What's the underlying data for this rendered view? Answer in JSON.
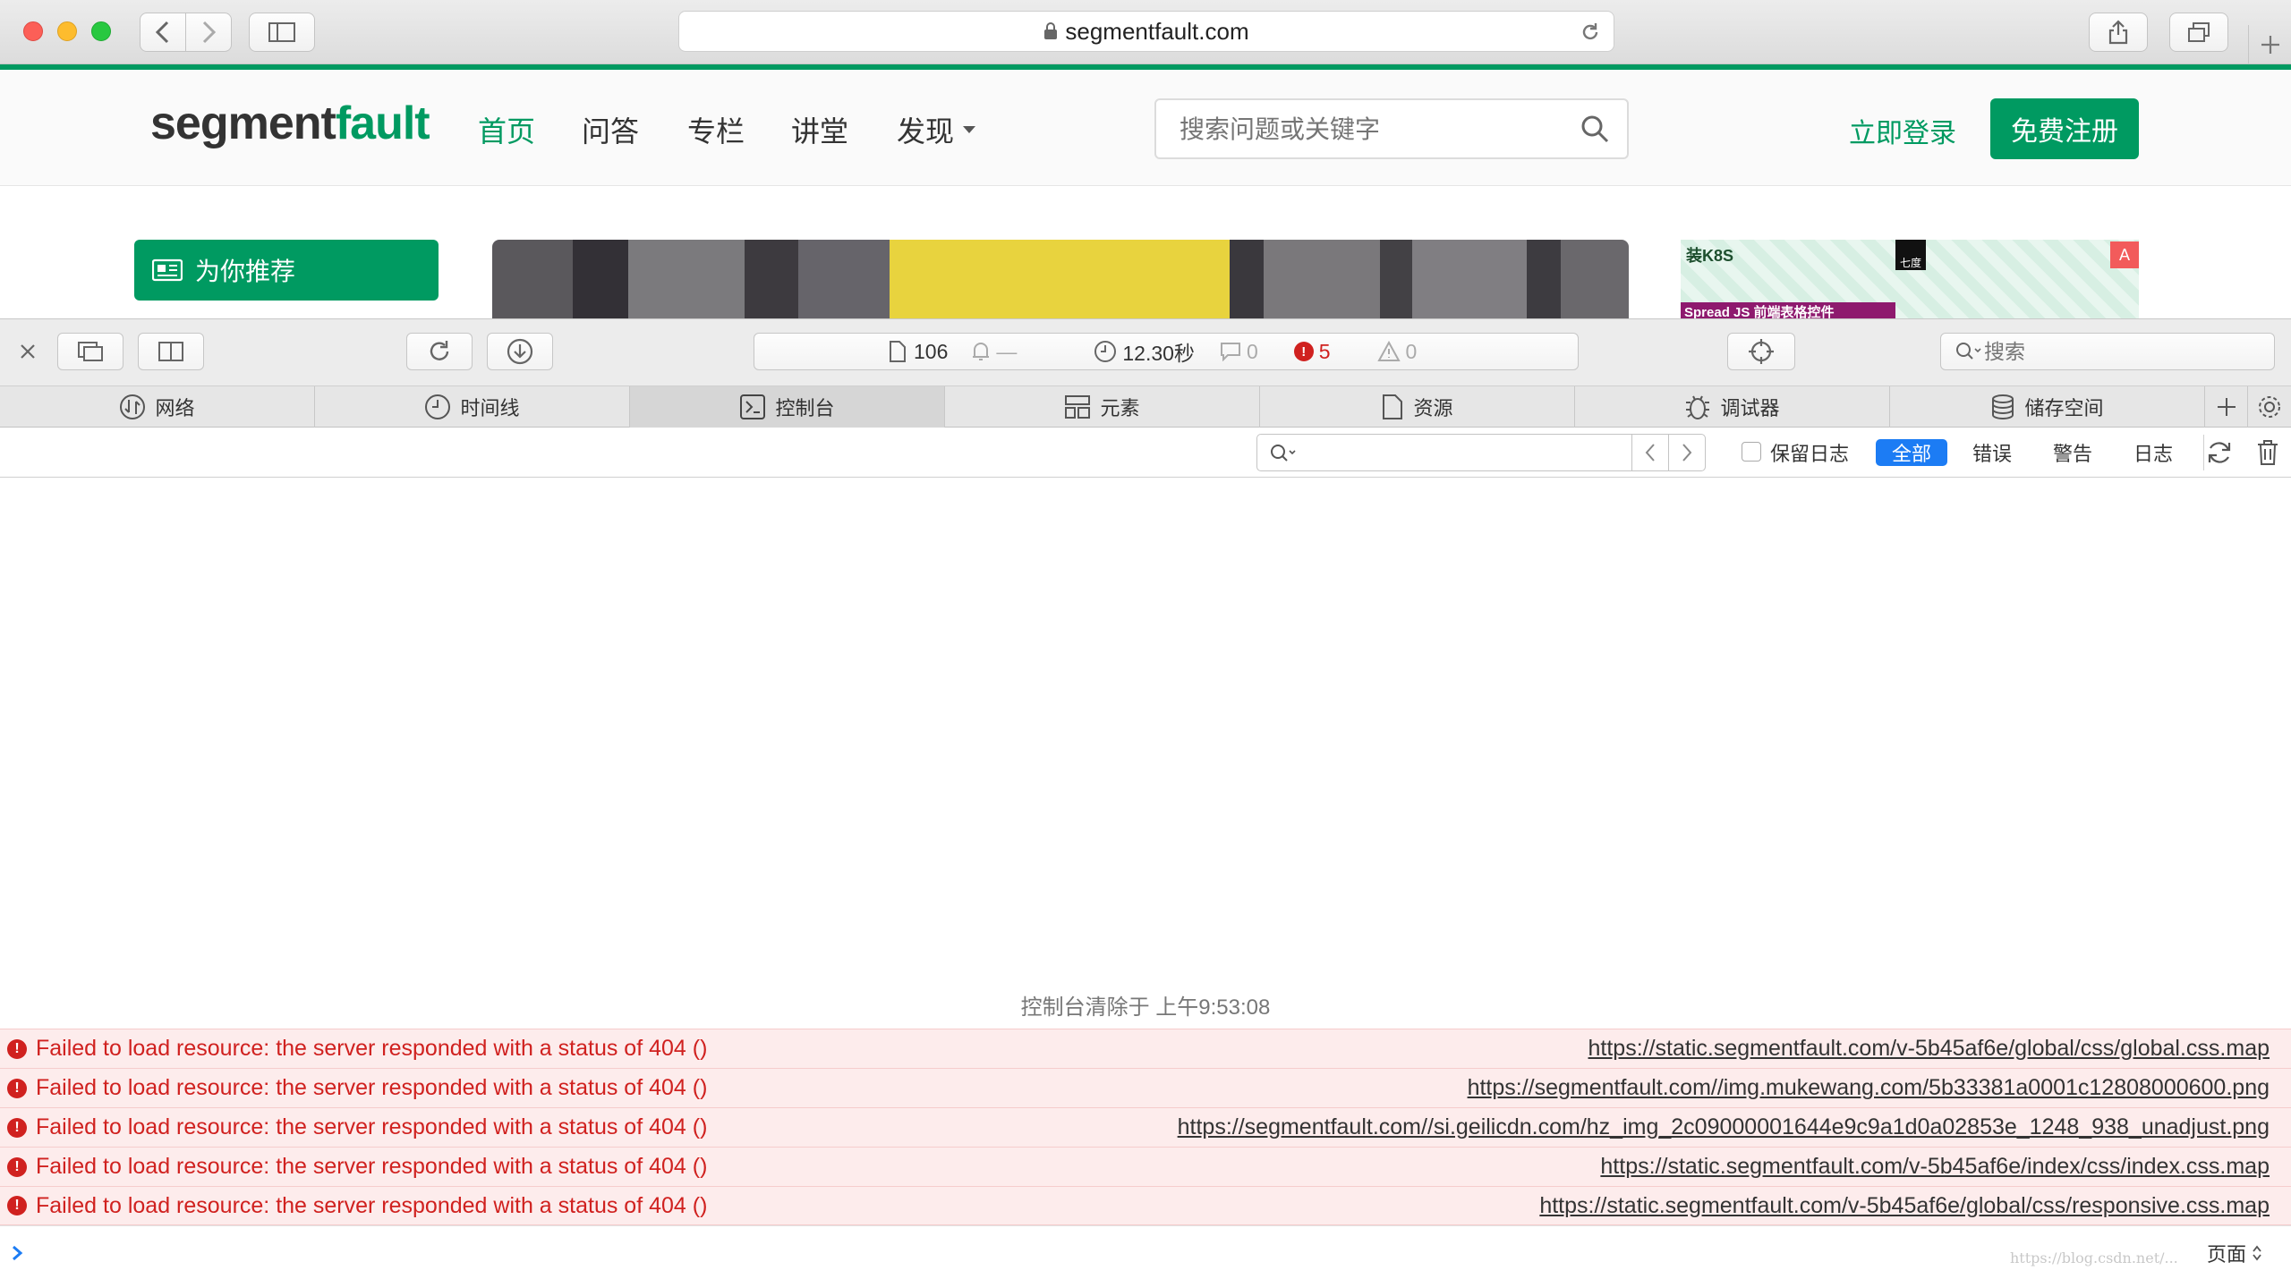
{
  "browser": {
    "address": "segmentfault.com"
  },
  "site": {
    "logo_bold": "segment",
    "logo_light": "fault",
    "nav": [
      "首页",
      "问答",
      "专栏",
      "讲堂",
      "发现"
    ],
    "search_placeholder": "搜索问题或关键字",
    "login": "立即登录",
    "register": "免费注册",
    "recommend": "为你推荐",
    "side_banner_label": "装K8S",
    "side_banner_sub": "Spread JS 前端表格控件",
    "side_banner_qr": "七度",
    "side_banner_badge": "A"
  },
  "devtools": {
    "resource_count": "106",
    "bell_count": "—",
    "load_time": "12.30秒",
    "message_count": "0",
    "error_count": "5",
    "warning_count": "0",
    "search_placeholder": "搜索",
    "tabs": [
      "网络",
      "时间线",
      "控制台",
      "元素",
      "资源",
      "调试器",
      "储存空间"
    ],
    "active_tab": "控制台",
    "preserve_log": "保留日志",
    "filters": [
      "全部",
      "错误",
      "警告",
      "日志"
    ],
    "console_cleared": "控制台清除于 上午9:53:08",
    "errors": [
      {
        "message": "Failed to load resource: the server responded with a status of 404 ()",
        "url": "https://static.segmentfault.com/v-5b45af6e/global/css/global.css.map"
      },
      {
        "message": "Failed to load resource: the server responded with a status of 404 ()",
        "url": "https://segmentfault.com//img.mukewang.com/5b33381a0001c12808000600.png"
      },
      {
        "message": "Failed to load resource: the server responded with a status of 404 ()",
        "url": "https://segmentfault.com//si.geilicdn.com/hz_img_2c09000001644e9c9a1d0a02853e_1248_938_unadjust.png"
      },
      {
        "message": "Failed to load resource: the server responded with a status of 404 ()",
        "url": "https://static.segmentfault.com/v-5b45af6e/index/css/index.css.map"
      },
      {
        "message": "Failed to load resource: the server responded with a status of 404 ()",
        "url": "https://static.segmentfault.com/v-5b45af6e/global/css/responsive.css.map"
      }
    ],
    "prompt_context": "页面",
    "watermark": "https://blog.csdn.net/..."
  },
  "colors": {
    "brand_green": "#009a61",
    "error_red": "#d0211f",
    "filter_active": "#1c7cf4"
  }
}
